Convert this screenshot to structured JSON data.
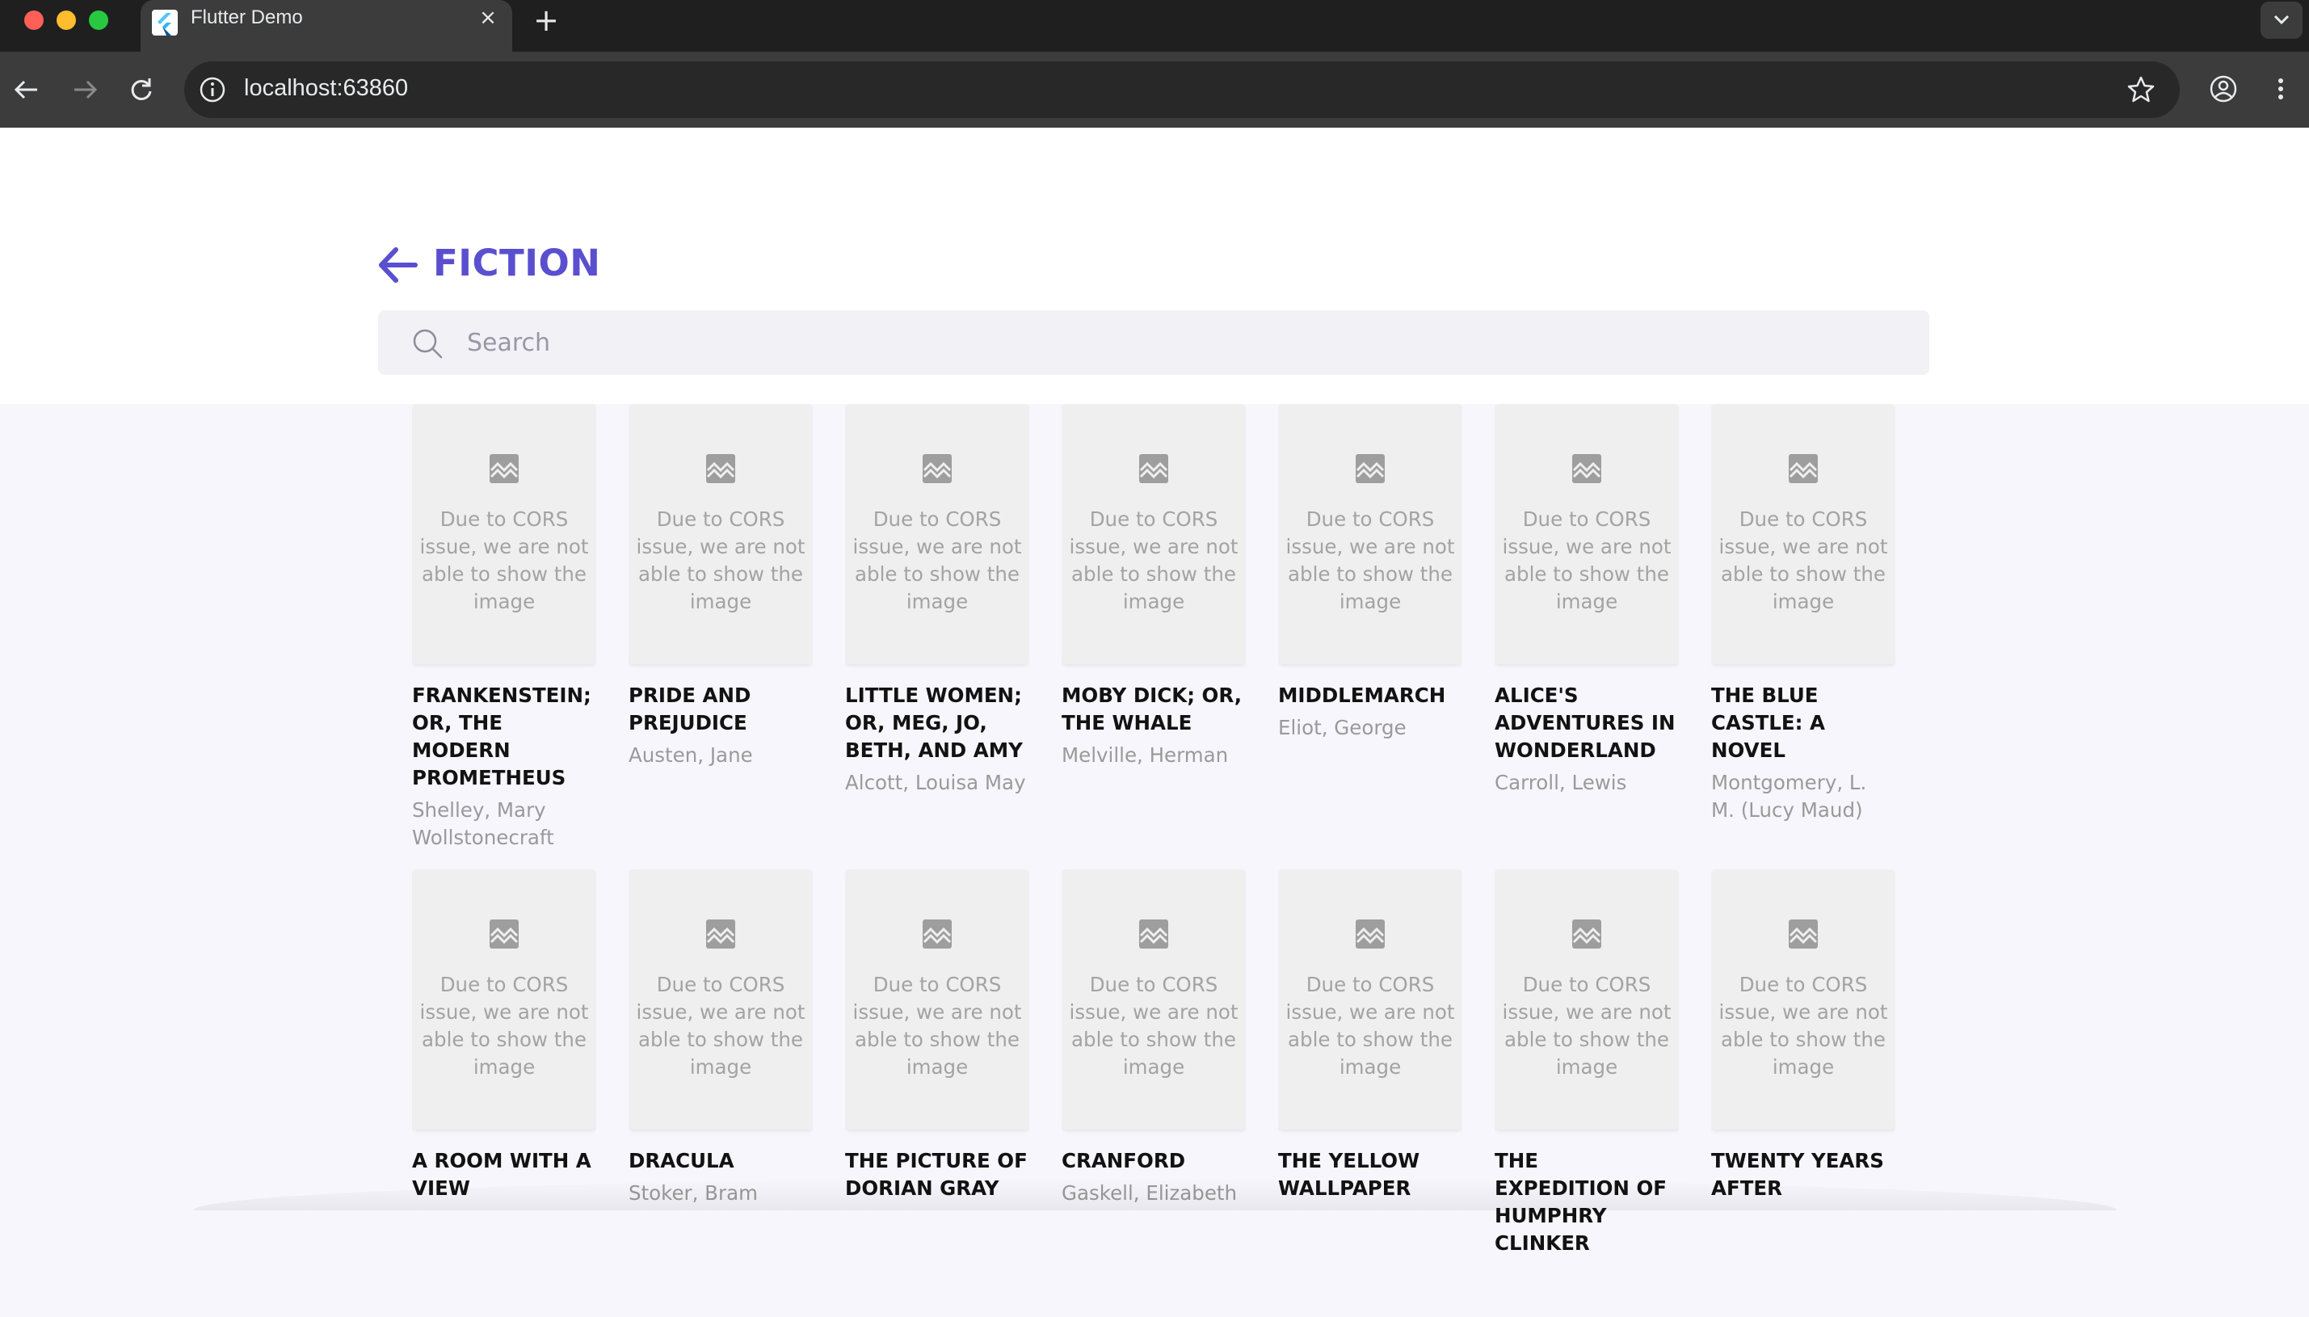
{
  "browser": {
    "tab_title": "Flutter Demo",
    "tab_close": "×",
    "new_tab": "+",
    "url": "localhost:63860"
  },
  "page": {
    "genre_title": "FICTION",
    "search_placeholder": "Search",
    "cover_message": "Due to CORS issue, we are not able to show the image",
    "accent_color": "#5a4fcf"
  },
  "books": [
    {
      "title": "Frankenstein; Or, The Modern Prometheus",
      "author": "Shelley, Mary Wollstonecraft"
    },
    {
      "title": "Pride and Prejudice",
      "author": "Austen, Jane"
    },
    {
      "title": "Little Women; Or, Meg, Jo, Beth, and Amy",
      "author": "Alcott, Louisa May"
    },
    {
      "title": "Moby Dick; Or, The Whale",
      "author": "Melville, Herman"
    },
    {
      "title": "Middlemarch",
      "author": "Eliot, George"
    },
    {
      "title": "Alice's Adventures in Wonderland",
      "author": "Carroll, Lewis"
    },
    {
      "title": "The Blue Castle: a novel",
      "author": "Montgomery, L. M. (Lucy Maud)"
    },
    {
      "title": "A Room with a View",
      "author": ""
    },
    {
      "title": "Dracula",
      "author": "Stoker, Bram"
    },
    {
      "title": "The Picture of Dorian Gray",
      "author": ""
    },
    {
      "title": "Cranford",
      "author": "Gaskell, Elizabeth"
    },
    {
      "title": "The Yellow Wallpaper",
      "author": ""
    },
    {
      "title": "The Expedition of Humphry Clinker",
      "author": ""
    },
    {
      "title": "Twenty Years After",
      "author": ""
    }
  ]
}
